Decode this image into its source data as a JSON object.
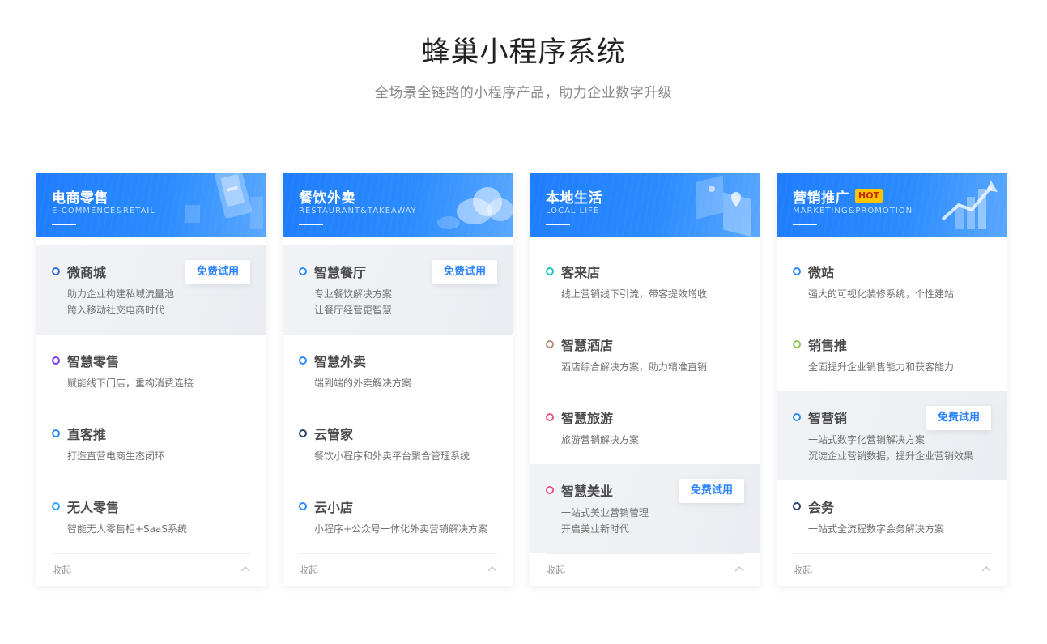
{
  "hero": {
    "title": "蜂巢小程序系统",
    "subtitle": "全场景全链路的小程序产品，助力企业数字升级"
  },
  "trial_label": "免费试用",
  "collapse_label": "收起",
  "colors": {
    "header_gradient_start": "#1f7dfd",
    "header_gradient_end": "#5aa8ff",
    "trial_text": "#2c83ff",
    "hot_badge": "#ffc400"
  },
  "cards": [
    {
      "title": "电商零售",
      "subtitle": "E-COMMENCE&RETAIL",
      "icon": "phone-illustration-icon",
      "items": [
        {
          "name": "微商城",
          "desc": [
            "助力企业构建私域流量池",
            "跨入移动社交电商时代"
          ],
          "dot_color": "#2f6fe6",
          "trial": true
        },
        {
          "name": "智慧零售",
          "desc": [
            "赋能线下门店，重构消费连接"
          ],
          "dot_color": "#7a3ff0",
          "trial": false
        },
        {
          "name": "直客推",
          "desc": [
            "打造直营电商生态闭环"
          ],
          "dot_color": "#2f8bff",
          "trial": false
        },
        {
          "name": "无人零售",
          "desc": [
            "智能无人零售柜+SaaS系统"
          ],
          "dot_color": "#31a8ff",
          "trial": false
        }
      ]
    },
    {
      "title": "餐饮外卖",
      "subtitle": "RESTAURANT&TAKEAWAY",
      "icon": "cloud-illustration-icon",
      "items": [
        {
          "name": "智慧餐厅",
          "desc": [
            "专业餐饮解决方案",
            "让餐厅经营更智慧"
          ],
          "dot_color": "#2f8bff",
          "trial": true
        },
        {
          "name": "智慧外卖",
          "desc": [
            "端到端的外卖解决方案"
          ],
          "dot_color": "#2f8bff",
          "trial": false
        },
        {
          "name": "云管家",
          "desc": [
            "餐饮小程序和外卖平台聚合管理系统"
          ],
          "dot_color": "#2f4468",
          "trial": false
        },
        {
          "name": "云小店",
          "desc": [
            "小程序+公众号一体化外卖营销解决方案"
          ],
          "dot_color": "#2f8bff",
          "trial": false
        }
      ]
    },
    {
      "title": "本地生活",
      "subtitle": "LOCAL LIFE",
      "icon": "location-illustration-icon",
      "items": [
        {
          "name": "客来店",
          "desc": [
            "线上营销线下引流，带客提效增收"
          ],
          "dot_color": "#20c2c7",
          "trial": false
        },
        {
          "name": "智慧酒店",
          "desc": [
            "酒店综合解决方案，助力精准直销"
          ],
          "dot_color": "#b0917b",
          "trial": false
        },
        {
          "name": "智慧旅游",
          "desc": [
            "旅游营销解决方案"
          ],
          "dot_color": "#f2557a",
          "trial": false
        },
        {
          "name": "智慧美业",
          "desc": [
            "一站式美业营销管理",
            "开启美业新时代"
          ],
          "dot_color": "#f2557a",
          "trial": true
        }
      ]
    },
    {
      "title": "营销推广",
      "hot": "HOT",
      "subtitle": "MARKETING&PROMOTION",
      "icon": "growth-chart-illustration-icon",
      "items": [
        {
          "name": "微站",
          "desc": [
            "强大的可视化装修系统，个性建站"
          ],
          "dot_color": "#2f8bff",
          "trial": false
        },
        {
          "name": "销售推",
          "desc": [
            "全面提升企业销售能力和获客能力"
          ],
          "dot_color": "#8cc85a",
          "trial": false
        },
        {
          "name": "智营销",
          "desc": [
            "一站式数字化营销解决方案",
            "沉淀企业营销数据，提升企业营销效果"
          ],
          "dot_color": "#2f8bff",
          "trial": true
        },
        {
          "name": "会务",
          "desc": [
            "一站式全流程数字会务解决方案"
          ],
          "dot_color": "#2f4468",
          "trial": false
        }
      ]
    }
  ]
}
